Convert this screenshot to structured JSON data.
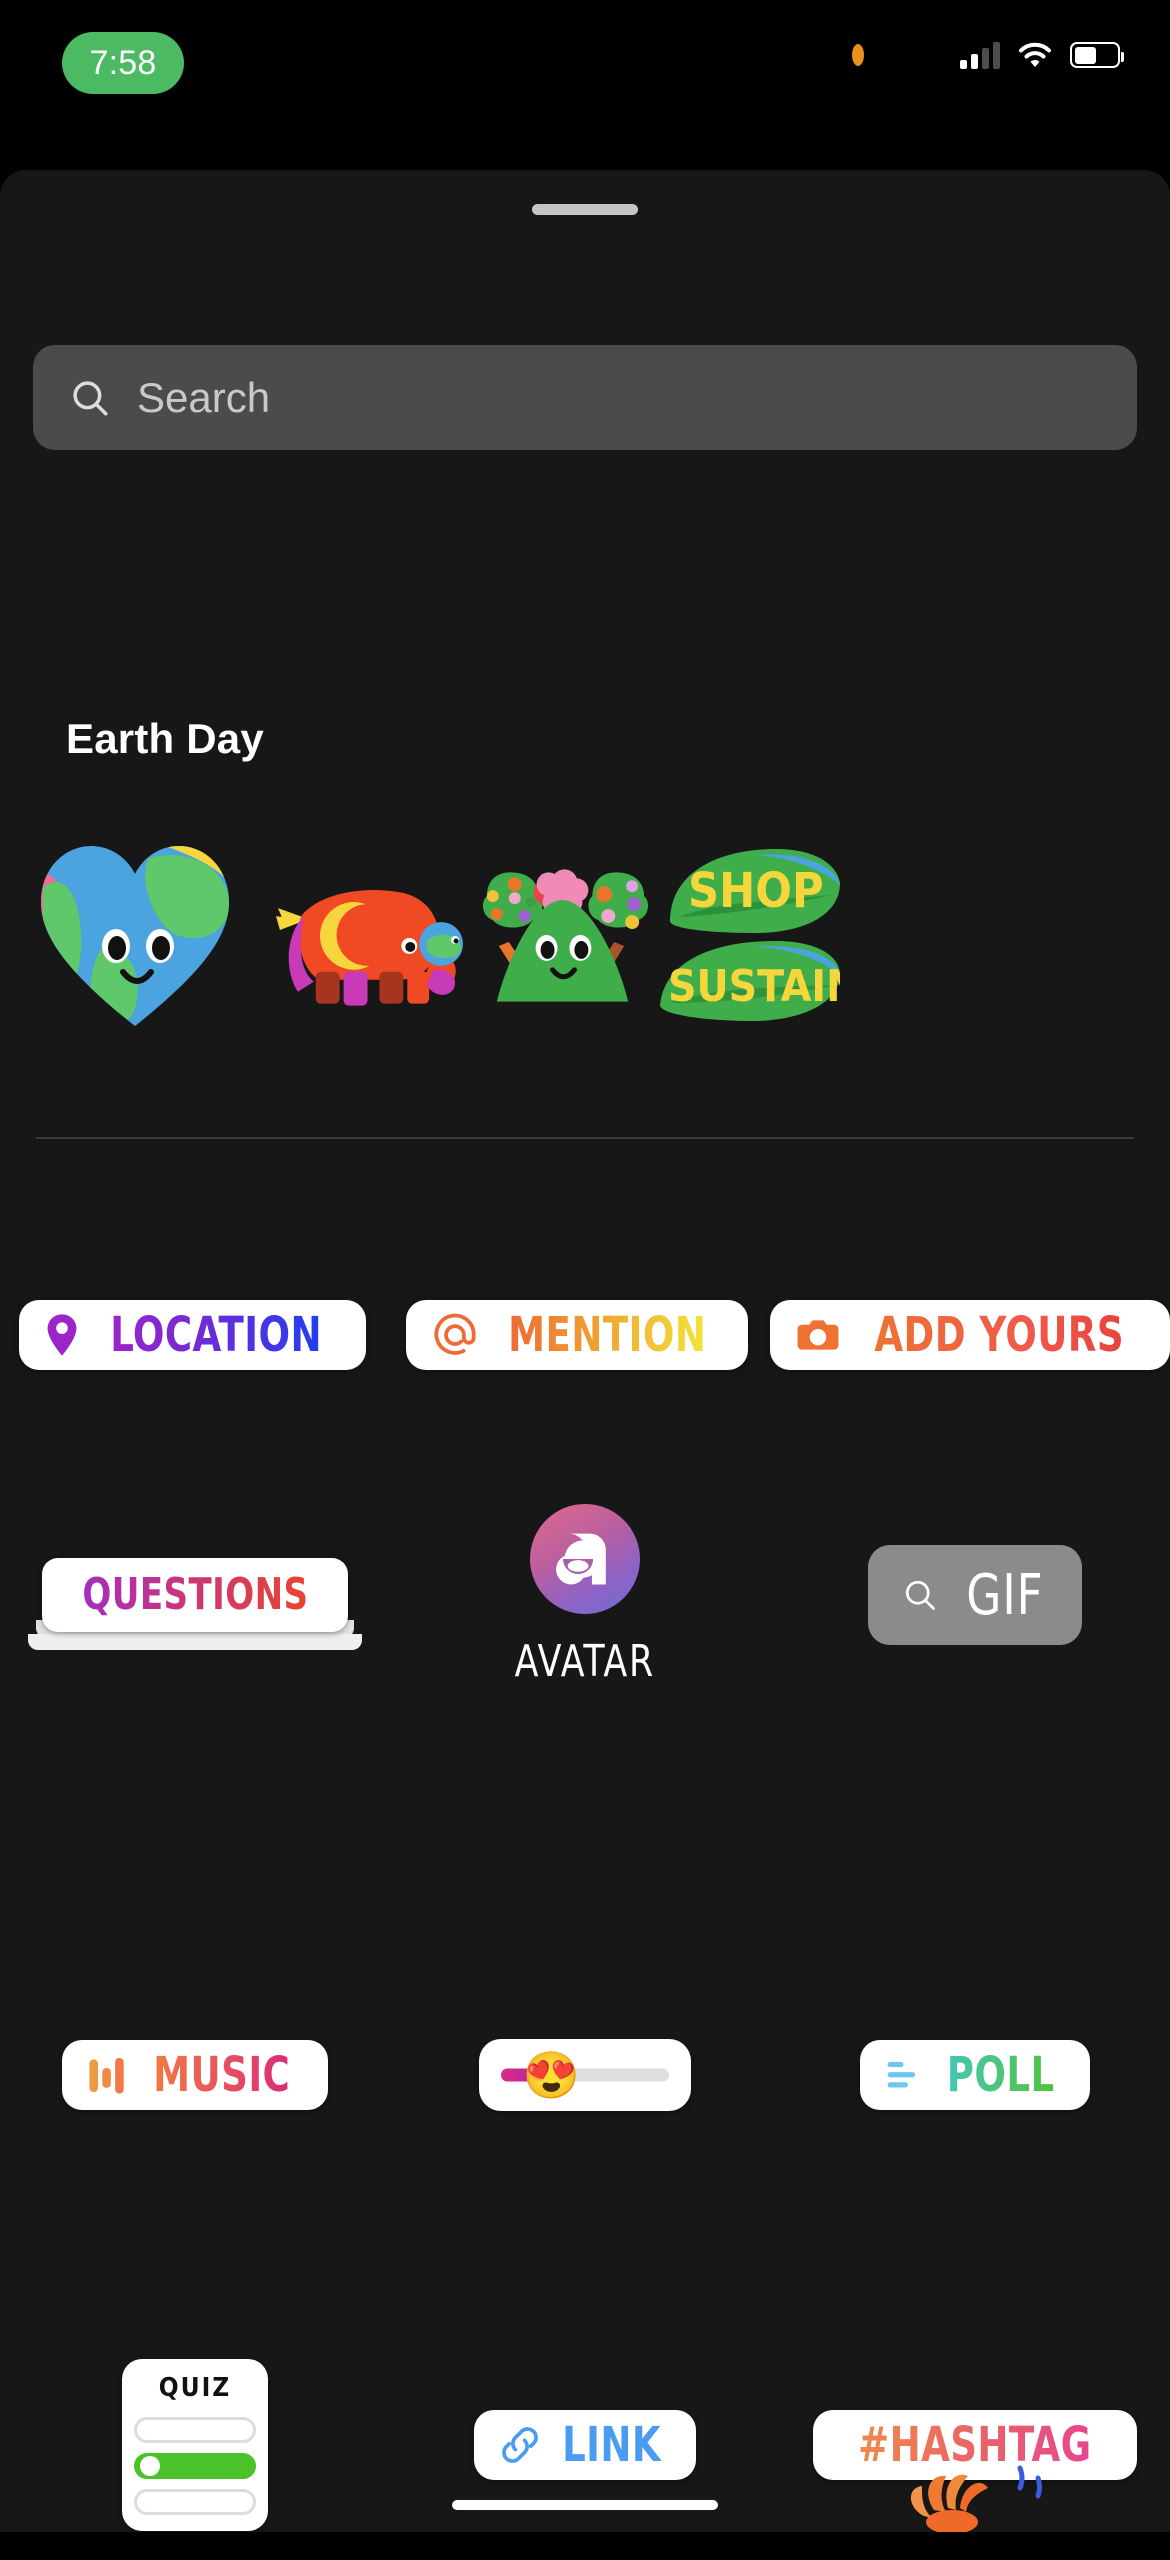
{
  "status_bar": {
    "time": "7:58",
    "time_pill_color": "#4cb963",
    "privacy_indicator": "orange-dot",
    "icons": [
      "cellular-signal-icon",
      "wifi-icon",
      "battery-icon"
    ],
    "battery_level_percent": 52
  },
  "sheet": {
    "background": "#171717",
    "grabber": "drag-handle"
  },
  "search": {
    "placeholder": "Search",
    "value": "",
    "icon": "search-icon",
    "background": "#4b4b4b"
  },
  "sections": [
    {
      "title": "Earth Day",
      "stickers": [
        {
          "name": "earth-heart",
          "label": "Earth Heart"
        },
        {
          "name": "elephant",
          "label": "Elephant"
        },
        {
          "name": "green-hill-trees",
          "label": "Hill and Trees"
        },
        {
          "name": "shop-sustainably-leaves",
          "label": "SHOP SUSTAINA"
        }
      ]
    }
  ],
  "sticker_rows": [
    {
      "items": [
        {
          "id": "location",
          "label": "LOCATION",
          "icon": "location-pin-icon",
          "gradient": "g-location",
          "icon_color": "#9b25c9"
        },
        {
          "id": "mention",
          "label": "MENTION",
          "icon": "at-sign-icon",
          "gradient": "g-mention",
          "icon_color": "#ef6a35"
        },
        {
          "id": "add-yours",
          "label": "ADD YOURS",
          "icon": "camera-icon",
          "gradient": "g-addyours",
          "icon_color": "#ef7233"
        }
      ]
    },
    {
      "items": [
        {
          "id": "questions",
          "label": "QUESTIONS",
          "icon": "none",
          "gradient": "g-questions"
        },
        {
          "id": "avatar",
          "label": "AVATAR",
          "icon": "avatar-glyph-icon"
        },
        {
          "id": "gif",
          "label": "GIF",
          "icon": "search-icon"
        }
      ]
    },
    {
      "items": [
        {
          "id": "music",
          "label": "MUSIC",
          "icon": "equalizer-icon",
          "gradient": "g-music"
        },
        {
          "id": "emoji-slider",
          "label": "",
          "emoji": "😍",
          "fill_percent": 30
        },
        {
          "id": "poll",
          "label": "POLL",
          "icon": "poll-bars-icon",
          "gradient": "g-poll",
          "icon_color": "#6cc8f0"
        }
      ]
    },
    {
      "items": [
        {
          "id": "quiz",
          "label": "QUIZ",
          "options_count": 3,
          "correct_index": 1,
          "correct_color": "#4cc22a"
        },
        {
          "id": "link",
          "label": "LINK",
          "icon": "chain-link-icon",
          "gradient": "g-link",
          "icon_color": "#4a9cf0"
        },
        {
          "id": "hashtag",
          "label": "#HASHTAG",
          "icon": "none",
          "gradient": "g-hashtag"
        }
      ]
    }
  ],
  "home_indicator": "home-indicator"
}
